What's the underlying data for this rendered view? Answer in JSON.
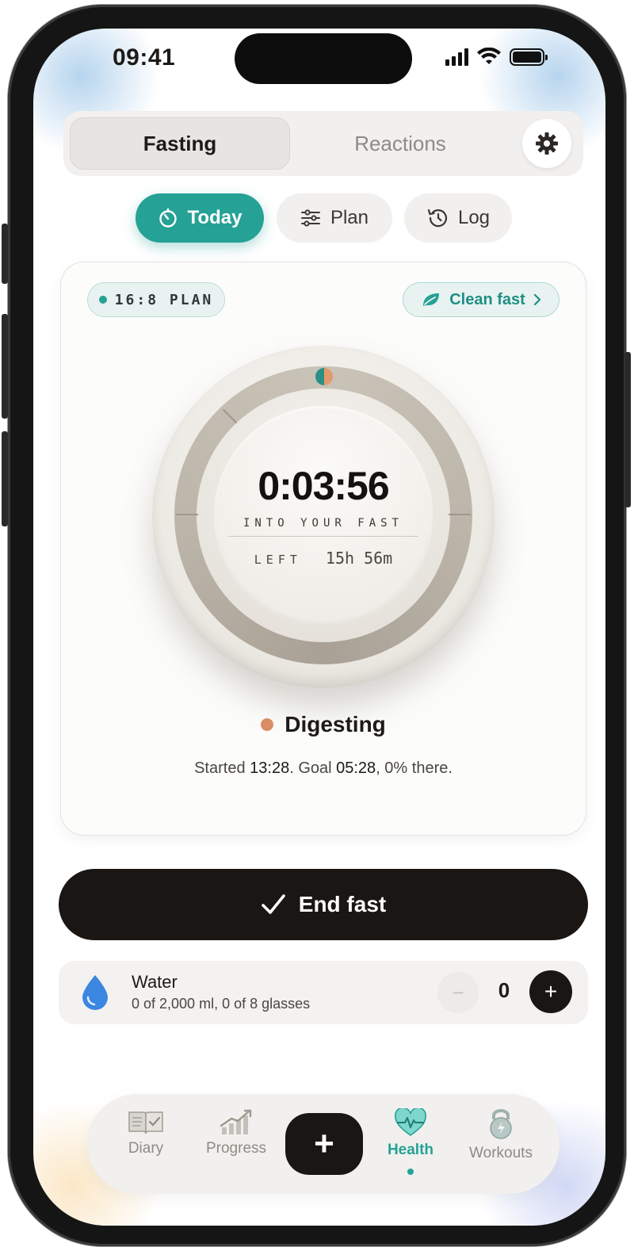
{
  "status": {
    "time": "09:41"
  },
  "segmented": {
    "active": "Fasting",
    "inactive": "Reactions"
  },
  "tabs": {
    "today": "Today",
    "plan": "Plan",
    "log": "Log"
  },
  "card": {
    "plan_badge": "16:8 PLAN",
    "clean_fast": "Clean fast",
    "timer": "0:03:56",
    "into_label": "INTO YOUR FAST",
    "left_label": "LEFT",
    "left_value": "15h 56m",
    "stage": "Digesting",
    "started_prefix": "Started ",
    "started_time": "13:28",
    "goal_prefix": ". Goal ",
    "goal_time": "05:28",
    "progress_text": ", 0% there.",
    "progress_percent": 0
  },
  "end_button": "End fast",
  "water": {
    "title": "Water",
    "subtitle": "0 of 2,000 ml, 0 of 8 glasses",
    "count": "0",
    "minus": "−",
    "plus": "+"
  },
  "tabbar": {
    "diary": "Diary",
    "progress": "Progress",
    "add": "+",
    "health": "Health",
    "workouts": "Workouts",
    "active": "Health"
  },
  "colors": {
    "accent": "#26a196",
    "dark": "#1a1614",
    "stage_dot": "#d98d62",
    "water_drop": "#3b86e0"
  }
}
